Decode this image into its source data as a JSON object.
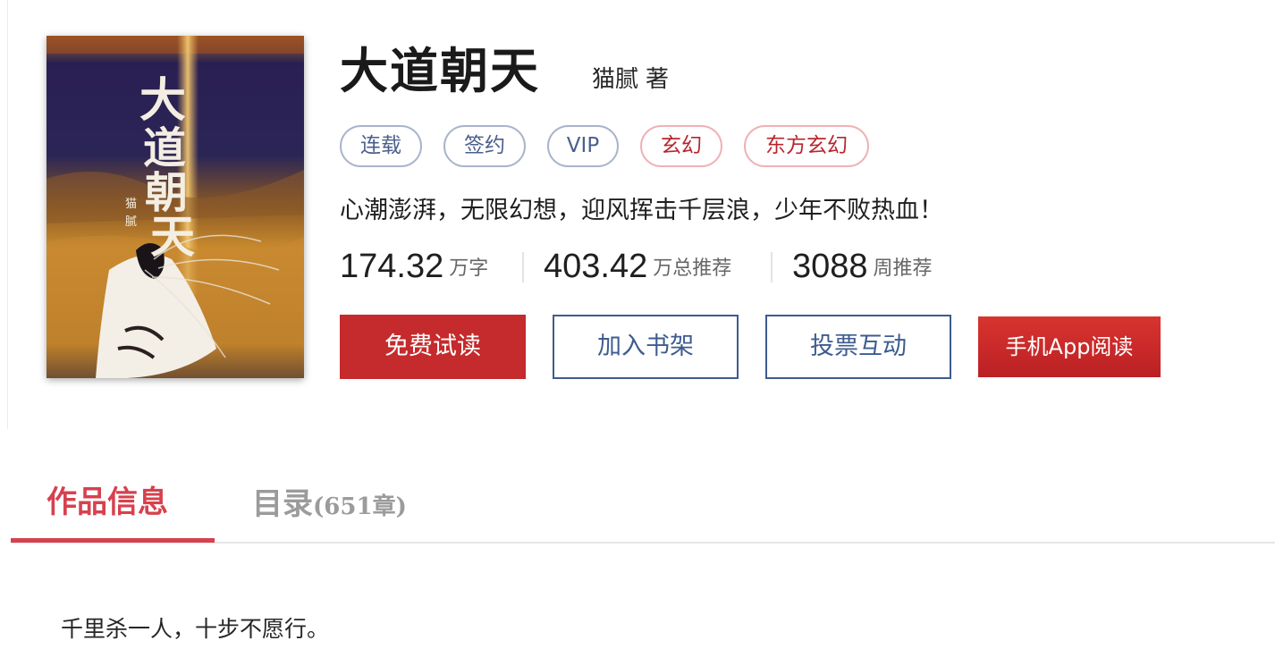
{
  "book": {
    "title": "大道朝天",
    "author": "猫腻",
    "author_suffix": "著",
    "tags": [
      {
        "label": "连载",
        "style": "status"
      },
      {
        "label": "签约",
        "style": "status"
      },
      {
        "label": "VIP",
        "style": "status"
      },
      {
        "label": "玄幻",
        "style": "genre"
      },
      {
        "label": "东方玄幻",
        "style": "genre"
      }
    ],
    "intro": "心潮澎湃，无限幻想，迎风挥击千层浪，少年不败热血！",
    "stats": [
      {
        "value": "174.32",
        "unit": "万字"
      },
      {
        "value": "403.42",
        "unit": "万总推荐"
      },
      {
        "value": "3088",
        "unit": "周推荐"
      }
    ],
    "cover": {
      "title_text": "大道朝天",
      "author_text": "猫腻"
    }
  },
  "actions": {
    "free_read": "免费试读",
    "add_shelf": "加入书架",
    "vote": "投票互动",
    "app_read": "手机App阅读"
  },
  "tabs": {
    "info": "作品信息",
    "toc": "目录",
    "toc_count": "(651章)"
  },
  "description": {
    "first_line": "千里杀一人，十步不愿行。"
  },
  "colors": {
    "accent_red": "#c52a2c",
    "tab_red": "#d6414e",
    "navy": "#3d5c8f",
    "tag_blue_border": "#a9b4cc",
    "tag_red_border": "#efb1b6"
  }
}
